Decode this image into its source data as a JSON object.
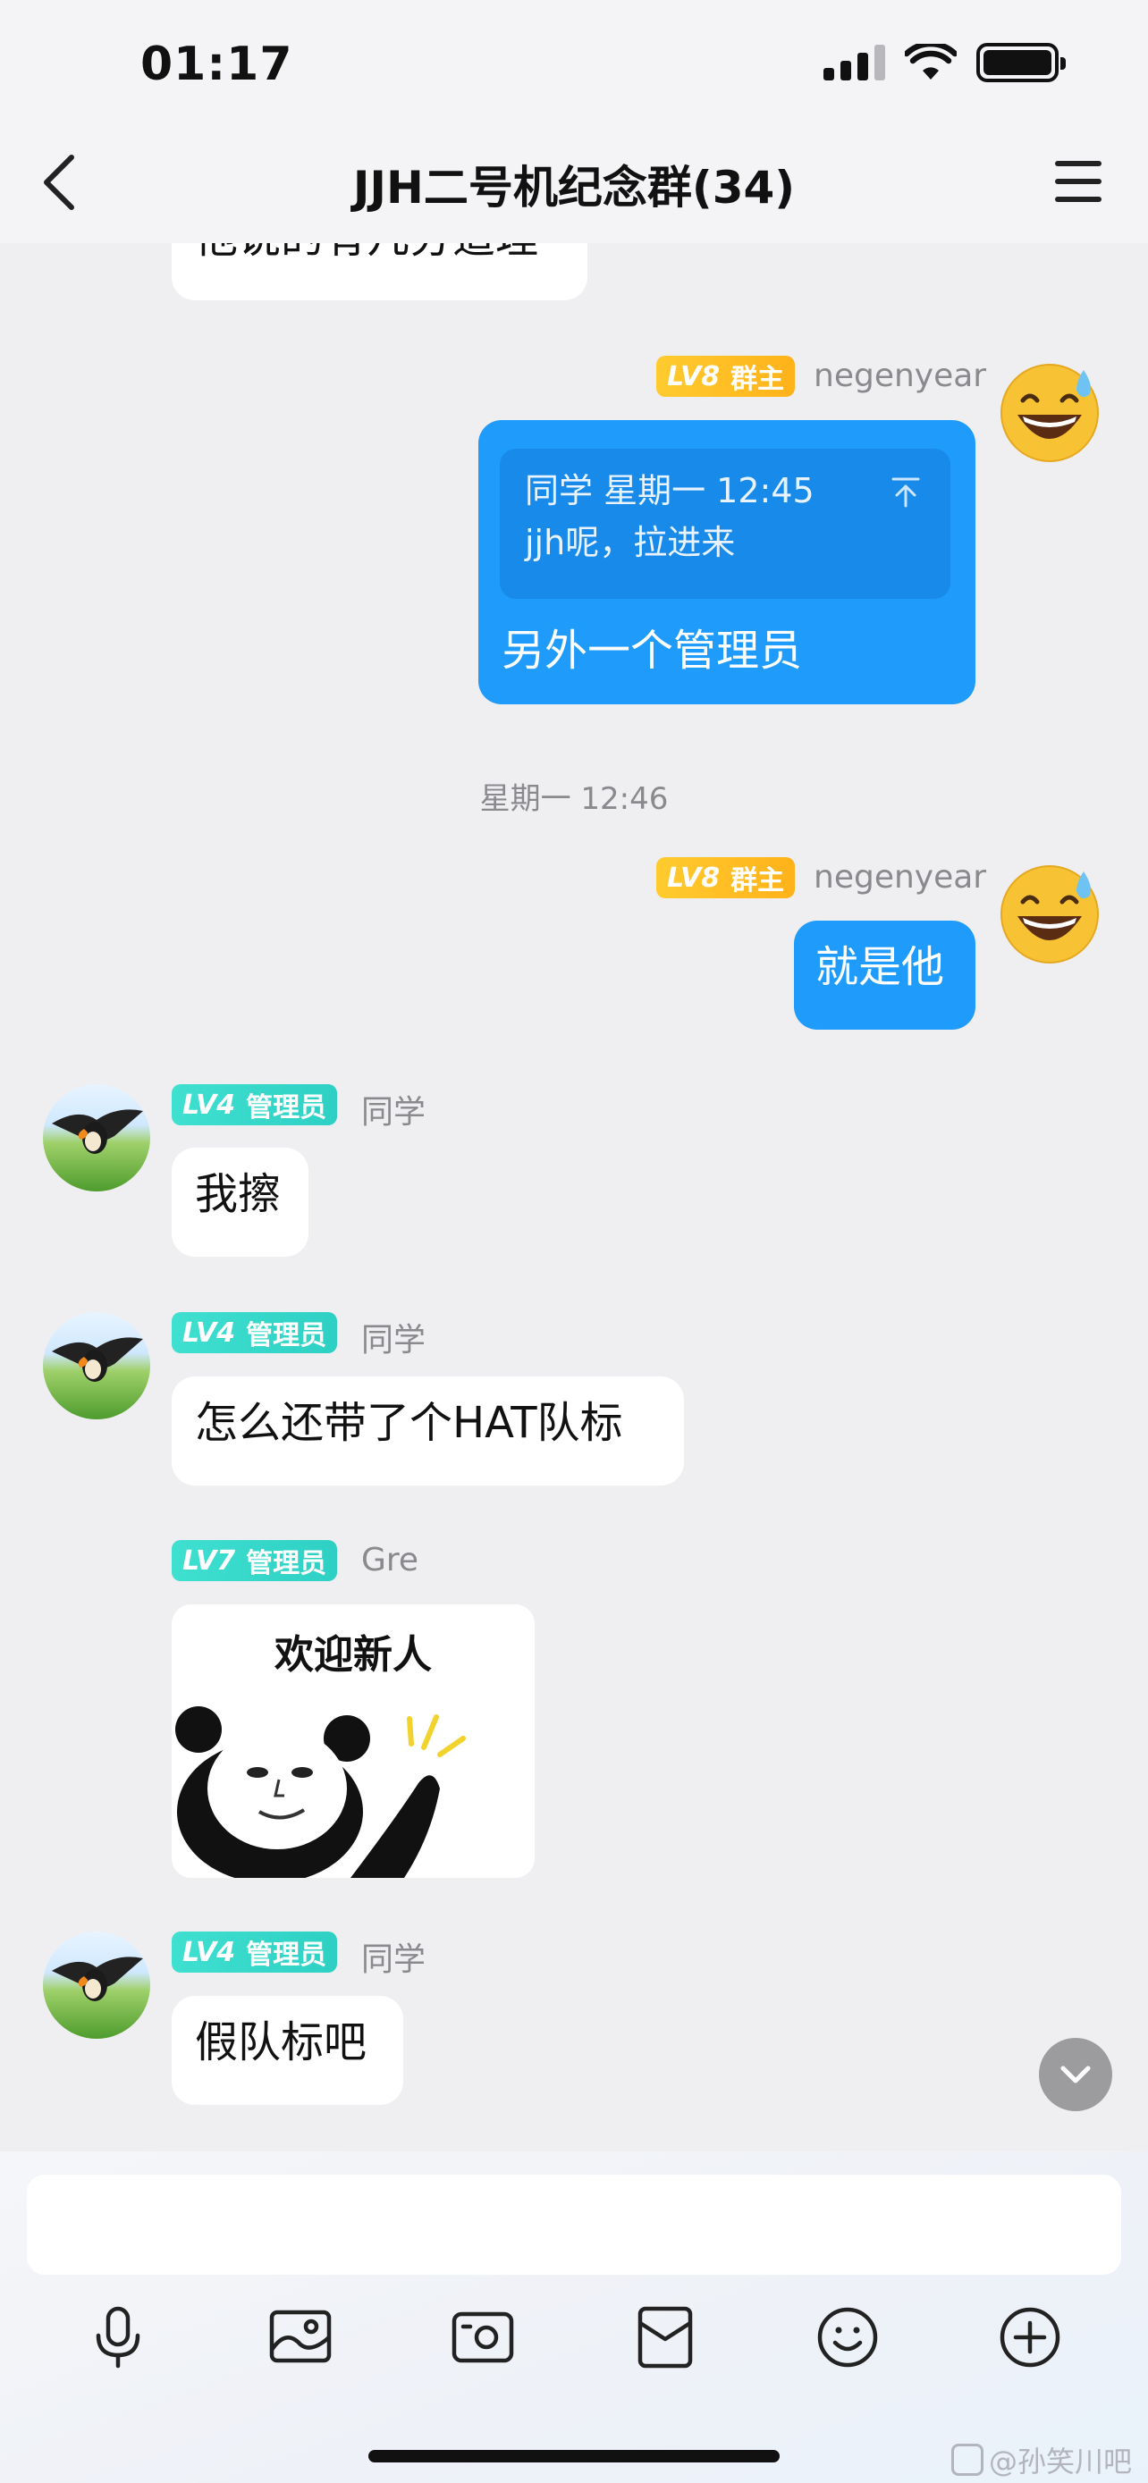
{
  "status_bar": {
    "time": "01:17"
  },
  "header": {
    "title": "JJH二号机纪念群(34)"
  },
  "messages": {
    "top_partial": {
      "text": "他说的有几分道理"
    },
    "m1": {
      "badge_level": "LV8",
      "badge_role": "群主",
      "sender": "negenyear",
      "quote_meta": "同学 星期一 12:45",
      "quote_text": "jjh呢，拉进来",
      "text": "另外一个管理员"
    },
    "timestamp": "星期一 12:46",
    "m2": {
      "badge_level": "LV8",
      "badge_role": "群主",
      "sender": "negenyear",
      "text": "就是他"
    },
    "m3": {
      "badge_level": "LV4",
      "badge_role": "管理员",
      "sender": "同学",
      "text": "我擦"
    },
    "m4": {
      "badge_level": "LV4",
      "badge_role": "管理员",
      "sender": "同学",
      "text": "怎么还带了个HAT队标"
    },
    "m5": {
      "badge_level": "LV7",
      "badge_role": "管理员",
      "sender": "Gre",
      "sticker_caption": "欢迎新人"
    },
    "m6": {
      "badge_level": "LV4",
      "badge_role": "管理员",
      "sender": "同学",
      "text": "假队标吧"
    }
  },
  "toolbar": {
    "icons": [
      "microphone-icon",
      "image-icon",
      "camera-icon",
      "red-packet-icon",
      "emoji-icon",
      "plus-icon"
    ]
  },
  "watermark": {
    "text": "@孙笑川吧"
  },
  "colors": {
    "accent_blue": "#1e9bfb",
    "badge_gold": "#ffbf25",
    "badge_teal": "#35d8ca",
    "background": "#efeff1"
  }
}
